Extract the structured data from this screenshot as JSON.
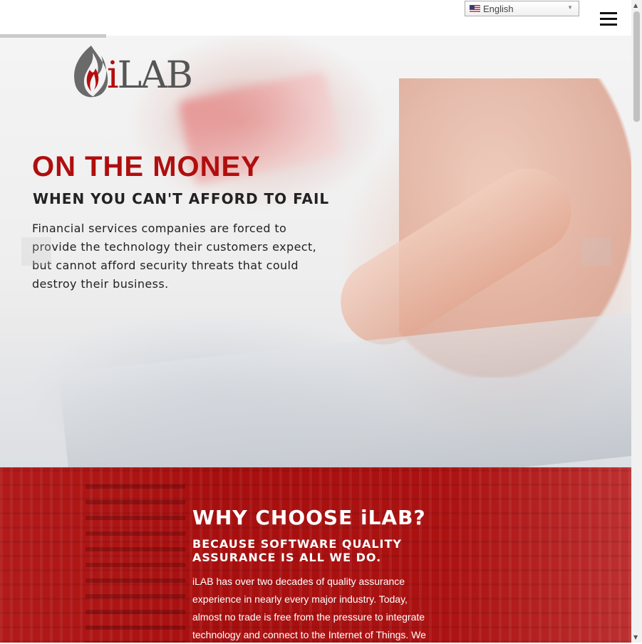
{
  "header": {
    "language_label": "English",
    "menu_icon": "hamburger-menu-icon",
    "flag_icon": "us-flag-icon",
    "caret_icon": "caret-down-icon"
  },
  "brand": {
    "logo_text_i": "i",
    "logo_text_rest": "LAB",
    "logo_icon": "flame-logo-icon",
    "accent_color": "#b00e0e"
  },
  "hero": {
    "title": "ON THE MONEY",
    "subtitle": "WHEN YOU CAN'T AFFORD TO FAIL",
    "body": "Financial services companies are forced to provide the technology their customers expect, but cannot afford security threats that could destroy their business."
  },
  "why": {
    "title": "WHY CHOOSE iLAB?",
    "subtitle": "BECAUSE SOFTWARE QUALITY ASSURANCE IS ALL WE DO.",
    "body": "iLAB has over two decades of quality assurance experience in nearly every major industry. Today, almost no trade is free from the pressure to integrate technology and connect to the Internet of Things. We",
    "background_color": "#a70f0f"
  }
}
